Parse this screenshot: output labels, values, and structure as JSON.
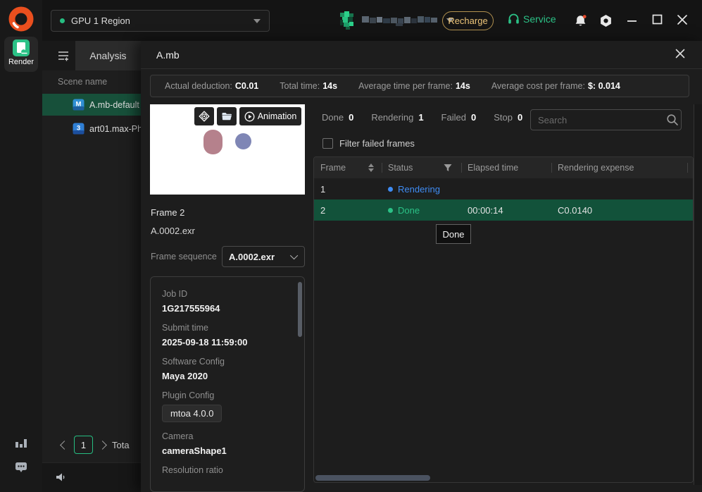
{
  "topbar": {
    "region": "GPU 1 Region",
    "recharge": "Recharge",
    "service": "Service"
  },
  "rail": {
    "render": "Render"
  },
  "sidebar": {
    "tab": "Analysis",
    "scene_header": "Scene name",
    "scene1": "A.mb-default",
    "scene2": "art01.max-Ph",
    "page": "1",
    "total": "Tota"
  },
  "panel": {
    "title": "A.mb",
    "stats": {
      "s1_label": "Actual deduction:",
      "s1_value": "C0.01",
      "s2_label": "Total time:",
      "s2_value": "14s",
      "s3_label": "Average time per frame:",
      "s3_value": "14s",
      "s4_label": "Average cost per frame:",
      "s4_value": "$: 0.014"
    },
    "preview": {
      "animation": "Animation",
      "frame": "Frame 2",
      "file": "A.0002.exr",
      "sequence_label": "Frame sequence",
      "sequence_value": "A.0002.exr"
    },
    "details": {
      "job_id_label": "Job ID",
      "job_id": "1G217555964",
      "submit_label": "Submit time",
      "submit": "2025-09-18 11:59:00",
      "software_label": "Software Config",
      "software": "Maya 2020",
      "plugin_label": "Plugin Config",
      "plugin": "mtoa 4.0.0",
      "camera_label": "Camera",
      "camera": "cameraShape1",
      "resolution_label": "Resolution ratio"
    },
    "frames": {
      "tab_done": "Done",
      "tab_done_count": "0",
      "tab_rendering": "Rendering",
      "tab_rendering_count": "1",
      "tab_failed": "Failed",
      "tab_failed_count": "0",
      "tab_stop": "Stop",
      "tab_stop_count": "0",
      "search_placeholder": "Search",
      "filter": "Filter failed frames",
      "col_frame": "Frame",
      "col_status": "Status",
      "col_elapsed": "Elapsed time",
      "col_expense": "Rendering expense",
      "rows": [
        {
          "frame": "1",
          "status": "Rendering",
          "elapsed": "",
          "expense": ""
        },
        {
          "frame": "2",
          "status": "Done",
          "elapsed": "00:00:14",
          "expense": "C0.0140"
        }
      ],
      "tooltip": "Done"
    }
  },
  "colors": {
    "accent_green": "#2bc186",
    "rendering_blue": "#3f8cf3",
    "recharge_gold": "#ecc478",
    "selected_row_green": "#12523a"
  }
}
